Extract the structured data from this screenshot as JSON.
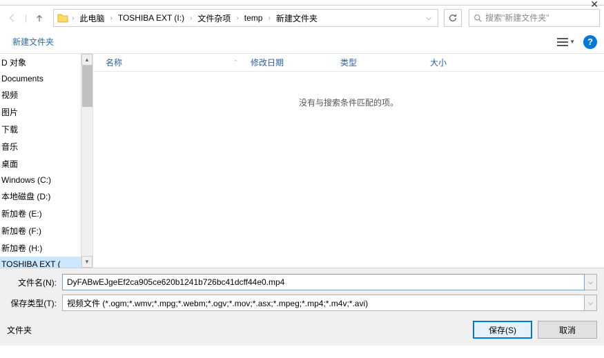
{
  "titlebar": {
    "close": "✕"
  },
  "nav": {
    "breadcrumbs": [
      "此电脑",
      "TOSHIBA EXT (I:)",
      "文件杂项",
      "temp",
      "新建文件夹"
    ]
  },
  "search": {
    "placeholder": "搜索\"新建文件夹\""
  },
  "toolbar": {
    "new_folder": "新建文件夹"
  },
  "sidebar": {
    "items": [
      "D 对象",
      "Documents",
      "视频",
      "图片",
      "下载",
      "音乐",
      "桌面",
      "Windows (C:)",
      "本地磁盘 (D:)",
      "新加卷 (E:)",
      "新加卷 (F:)",
      "新加卷 (H:)",
      "TOSHIBA EXT ("
    ],
    "selected_index": 12
  },
  "columns": {
    "name": "名称",
    "date": "修改日期",
    "type": "类型",
    "size": "大小"
  },
  "main": {
    "empty_message": "没有与搜索条件匹配的项。"
  },
  "form": {
    "filename_label": "文件名(N):",
    "filename_value": "DyFABwEJgeEf2ca905ce620b1241b726bc41dcff44e0.mp4",
    "type_label": "保存类型(T):",
    "type_value": "视频文件 (*.ogm;*.wmv;*.mpg;*.webm;*.ogv;*.mov;*.asx;*.mpeg;*.mp4;*.m4v;*.avi)"
  },
  "buttons": {
    "folders": "文件夹",
    "save": "保存(S)",
    "cancel": "取消"
  }
}
